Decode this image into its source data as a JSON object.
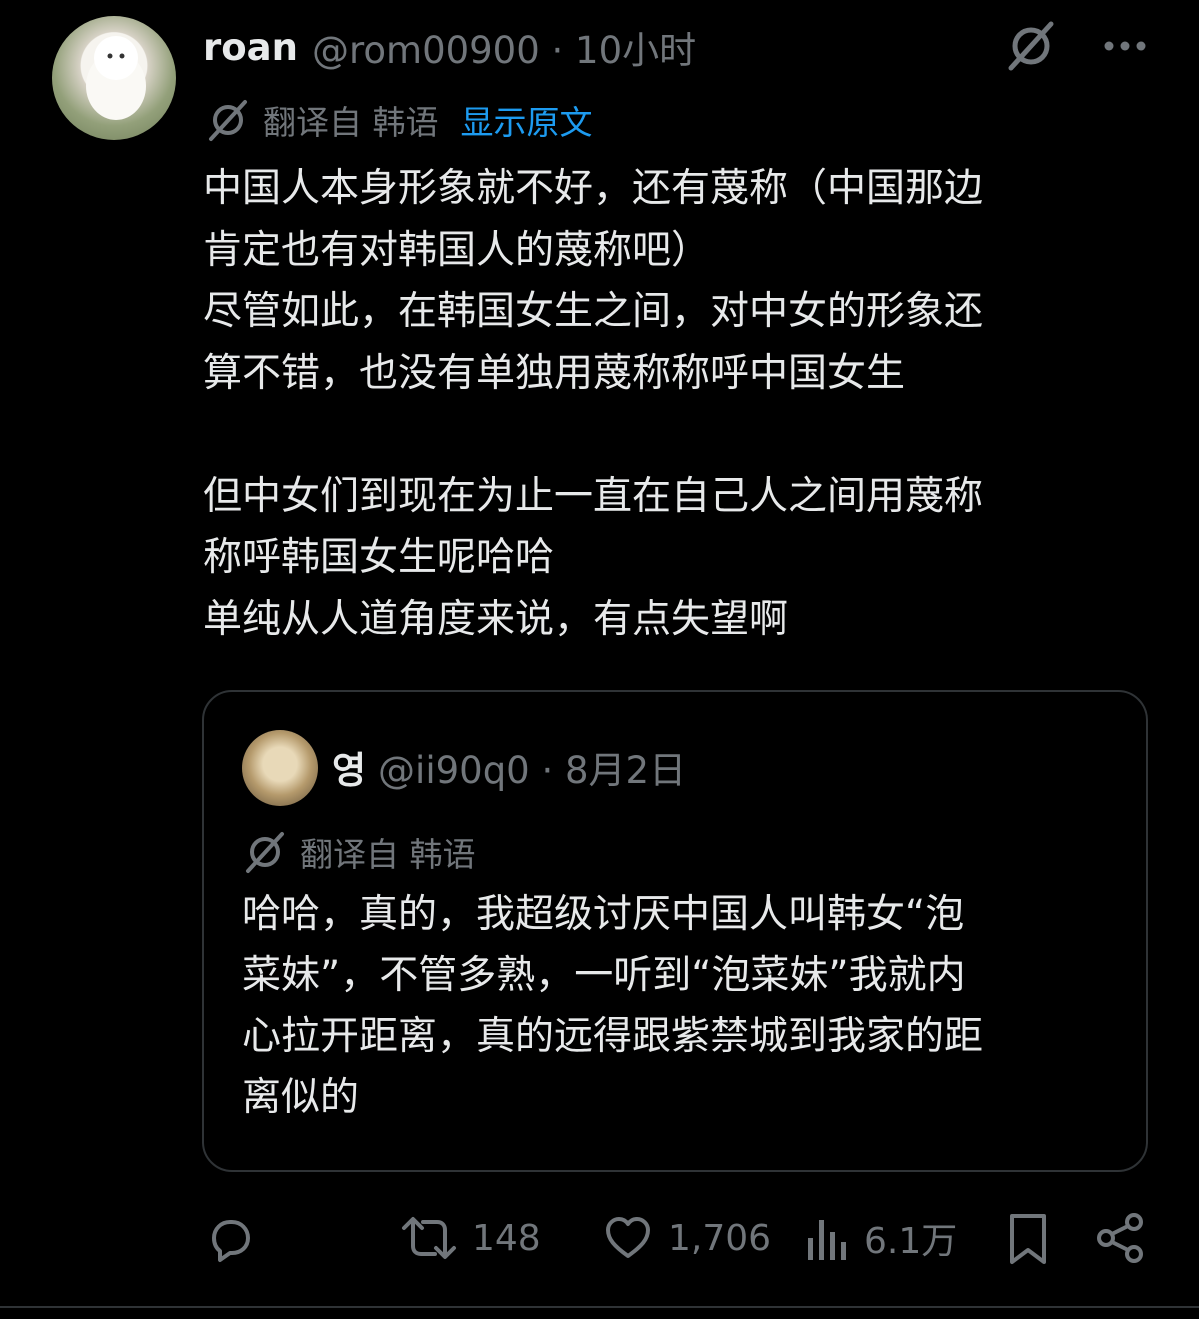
{
  "post": {
    "author_name": "roan",
    "meta": "@rom00900 · 10小时",
    "translation_label": "翻译自 韩语",
    "show_original": "显示原文",
    "text": "中国人本身形象就不好，还有蔑称（中国那边\n肯定也有对韩国人的蔑称吧）\n尽管如此，在韩国女生之间，对中女的形象还\n算不错，也没有单独用蔑称称呼中国女生\n\n但中女们到现在为止一直在自己人之间用蔑称\n称呼韩国女生呢哈哈\n单纯从人道角度来说，有点失望啊"
  },
  "quote": {
    "author_name": "영",
    "meta": "@ii90q0 · 8月2日",
    "translation_label": "翻译自 韩语",
    "text": "哈哈，真的，我超级讨厌中国人叫韩女“泡\n菜妹”，不管多熟，一听到“泡菜妹”我就内\n心拉开距离，真的远得跟紫禁城到我家的距\n离似的"
  },
  "actions": {
    "retweets": "148",
    "likes": "1,706",
    "views": "6.1万"
  },
  "icons": [
    "grok-icon",
    "more-icon",
    "translate-icon",
    "reply-icon",
    "retweet-icon",
    "like-icon",
    "views-icon",
    "bookmark-icon",
    "share-icon"
  ],
  "colors": {
    "background": "#000000",
    "text": "#e7e9ea",
    "secondary": "#71767b",
    "link": "#1d9bf0",
    "border": "#2f3336"
  }
}
